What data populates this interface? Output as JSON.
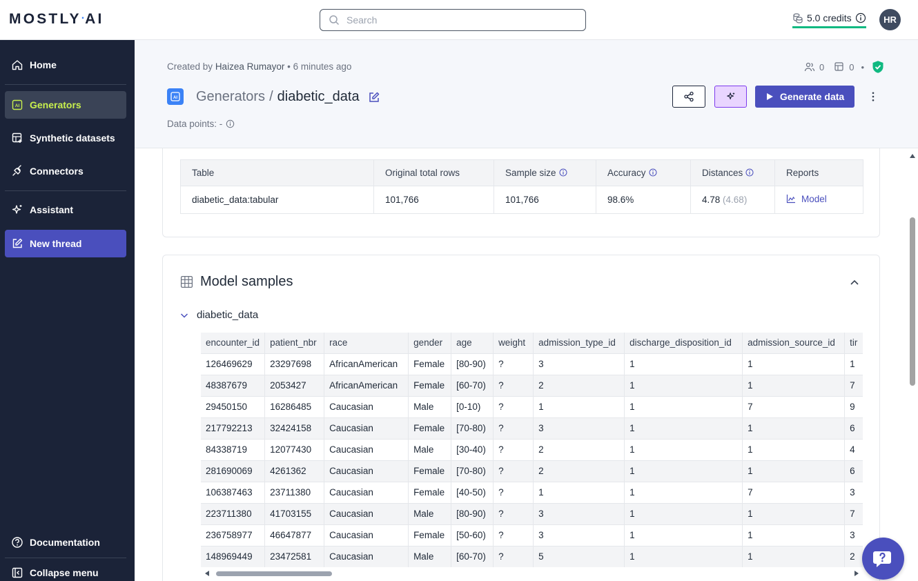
{
  "brand": {
    "logo_left": "MOSTLY",
    "logo_dot": "·",
    "logo_right": "AI"
  },
  "search": {
    "placeholder": "Search"
  },
  "credits": {
    "label": "5.0 credits"
  },
  "user": {
    "initials": "HR"
  },
  "sidebar": {
    "items": [
      {
        "label": "Home",
        "icon": "home-icon"
      },
      {
        "label": "Generators",
        "icon": "generator-icon",
        "active": true
      },
      {
        "label": "Synthetic datasets",
        "icon": "dataset-icon"
      },
      {
        "label": "Connectors",
        "icon": "plug-icon"
      },
      {
        "label": "Assistant",
        "icon": "sparkle-icon"
      },
      {
        "label": "New thread",
        "icon": "pencil-square-icon"
      }
    ],
    "documentation": "Documentation",
    "collapse": "Collapse menu"
  },
  "header": {
    "created_prefix": "Created by",
    "created_user": "Haizea Rumayor",
    "created_sep": "•",
    "created_time": "6 minutes ago",
    "users_count": "0",
    "models_count": "0",
    "stats_sep": "•",
    "breadcrumb_parent": "Generators",
    "breadcrumb_sep": "/",
    "breadcrumb_current": "diabetic_data",
    "data_points": "Data points: -",
    "generate_label": "Generate data"
  },
  "summary": {
    "columns": [
      "Table",
      "Original total rows",
      "Sample size",
      "Accuracy",
      "Distances",
      "Reports"
    ],
    "row": {
      "table": "diabetic_data:tabular",
      "original_rows": "101,766",
      "sample_size": "101,766",
      "accuracy": "98.6%",
      "distance_main": "4.78",
      "distance_ref": "(4.68)",
      "report": "Model"
    }
  },
  "samples": {
    "title": "Model samples",
    "table_name": "diabetic_data",
    "columns": [
      "encounter_id",
      "patient_nbr",
      "race",
      "gender",
      "age",
      "weight",
      "admission_type_id",
      "discharge_disposition_id",
      "admission_source_id",
      "tir"
    ],
    "rows": [
      [
        "126469629",
        "23297698",
        "AfricanAmerican",
        "Female",
        "[80-90)",
        "?",
        "3",
        "1",
        "1",
        "1"
      ],
      [
        "48387679",
        "2053427",
        "AfricanAmerican",
        "Female",
        "[60-70)",
        "?",
        "2",
        "1",
        "1",
        "7"
      ],
      [
        "29450150",
        "16286485",
        "Caucasian",
        "Male",
        "[0-10)",
        "?",
        "1",
        "1",
        "7",
        "9"
      ],
      [
        "217792213",
        "32424158",
        "Caucasian",
        "Female",
        "[70-80)",
        "?",
        "3",
        "1",
        "1",
        "6"
      ],
      [
        "84338719",
        "12077430",
        "Caucasian",
        "Male",
        "[30-40)",
        "?",
        "2",
        "1",
        "1",
        "4"
      ],
      [
        "281690069",
        "4261362",
        "Caucasian",
        "Female",
        "[70-80)",
        "?",
        "2",
        "1",
        "1",
        "6"
      ],
      [
        "106387463",
        "23711380",
        "Caucasian",
        "Female",
        "[40-50)",
        "?",
        "1",
        "1",
        "7",
        "3"
      ],
      [
        "223711380",
        "41703155",
        "Caucasian",
        "Male",
        "[80-90)",
        "?",
        "3",
        "1",
        "1",
        "7"
      ],
      [
        "236758977",
        "46647877",
        "Caucasian",
        "Female",
        "[50-60)",
        "?",
        "3",
        "1",
        "1",
        "3"
      ],
      [
        "148969449",
        "23472581",
        "Caucasian",
        "Male",
        "[60-70)",
        "?",
        "5",
        "1",
        "1",
        "2"
      ]
    ]
  },
  "colors": {
    "sidebar_bg": "#1b2338",
    "active_text": "#c8f04d",
    "primary": "#4a4fbd",
    "credits_underline": "#10b981",
    "shield": "#10b981"
  }
}
